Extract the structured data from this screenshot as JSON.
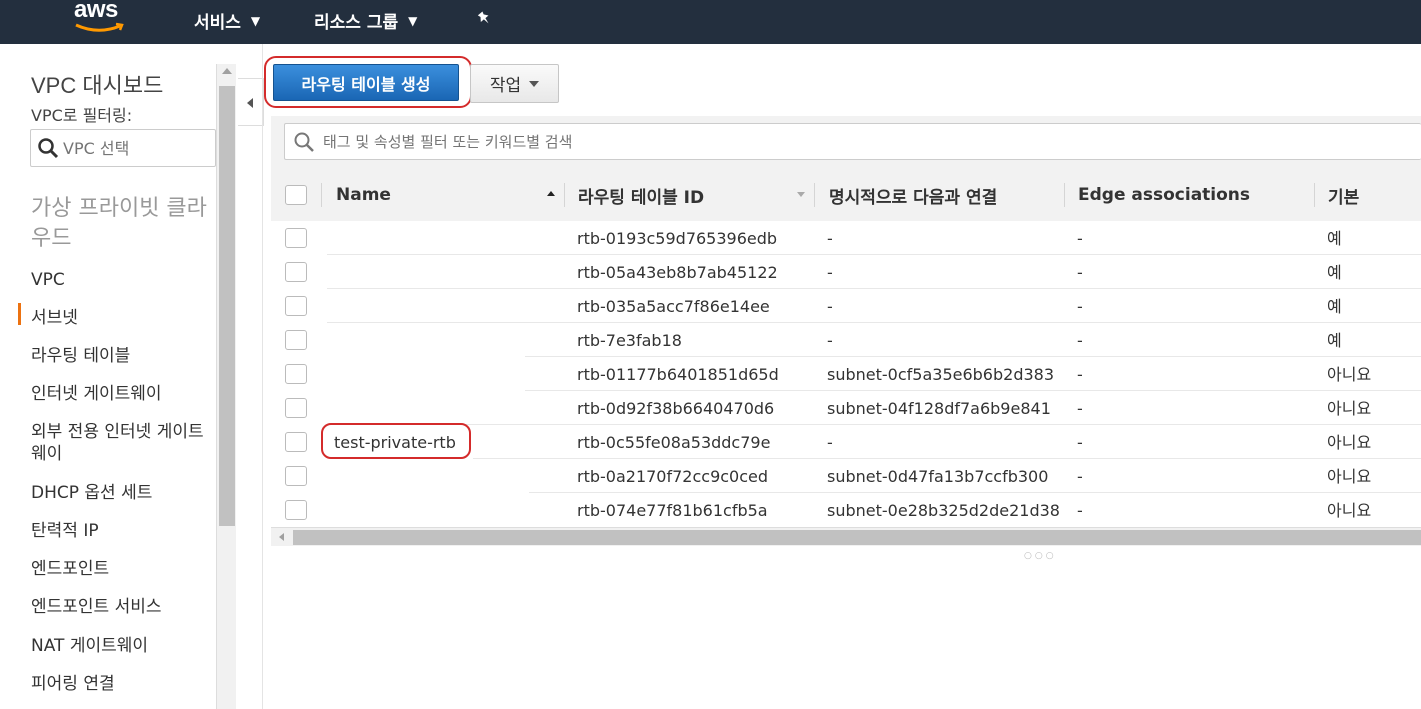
{
  "topnav": {
    "logo": "aws",
    "services_label": "서비스",
    "resource_groups_label": "리소스 그룹"
  },
  "sidebar": {
    "title": "VPC 대시보드",
    "filter_label": "VPC로 필터링:",
    "vpc_select_placeholder": "VPC 선택",
    "section": "가상 프라이빗 클라우드",
    "items": [
      "VPC",
      "서브넷",
      "라우팅 테이블",
      "인터넷 게이트웨이",
      "외부 전용 인터넷 게이트웨이",
      "DHCP 옵션 세트",
      "탄력적 IP",
      "엔드포인트",
      "엔드포인트 서비스",
      "NAT 게이트웨이",
      "피어링 연결"
    ],
    "active_item": "라우팅 테이블",
    "active_color": "#ec7211"
  },
  "toolbar": {
    "create_label": "라우팅 테이블 생성",
    "action_label": "작업"
  },
  "search": {
    "placeholder": "태그 및 속성별 필터 또는 키워드별 검색"
  },
  "table": {
    "columns": [
      "Name",
      "라우팅 테이블 ID",
      "명시적으로 다음과 연결",
      "Edge associations",
      "기본"
    ],
    "rows": [
      {
        "name": "",
        "id": "rtb-0193c59d765396edb",
        "assoc": "-",
        "edge": "-",
        "main": "예"
      },
      {
        "name": "",
        "id": "rtb-05a43eb8b7ab45122",
        "assoc": "-",
        "edge": "-",
        "main": "예"
      },
      {
        "name": "",
        "id": "rtb-035a5acc7f86e14ee",
        "assoc": "-",
        "edge": "-",
        "main": "예"
      },
      {
        "name": "",
        "id": "rtb-7e3fab18",
        "assoc": "-",
        "edge": "-",
        "main": "예"
      },
      {
        "name": "",
        "id": "rtb-01177b6401851d65d",
        "assoc": "subnet-0cf5a35e6b6b2d383",
        "edge": "-",
        "main": "아니요"
      },
      {
        "name": "",
        "id": "rtb-0d92f38b6640470d6",
        "assoc": "subnet-04f128df7a6b9e841",
        "edge": "-",
        "main": "아니요"
      },
      {
        "name": "test-private-rtb",
        "id": "rtb-0c55fe08a53ddc79e",
        "assoc": "-",
        "edge": "-",
        "main": "아니요"
      },
      {
        "name": "",
        "id": "rtb-0a2170f72cc9c0ced",
        "assoc": "subnet-0d47fa13b7ccfb300",
        "edge": "-",
        "main": "아니요"
      },
      {
        "name": "",
        "id": "rtb-074e77f81b61cfb5a",
        "assoc": "subnet-0e28b325d2de21d38",
        "edge": "-",
        "main": "아니요"
      }
    ]
  },
  "colors": {
    "nav_bg": "#232f3e",
    "primary_button": "#1e73be",
    "highlight": "#d42b2b"
  }
}
